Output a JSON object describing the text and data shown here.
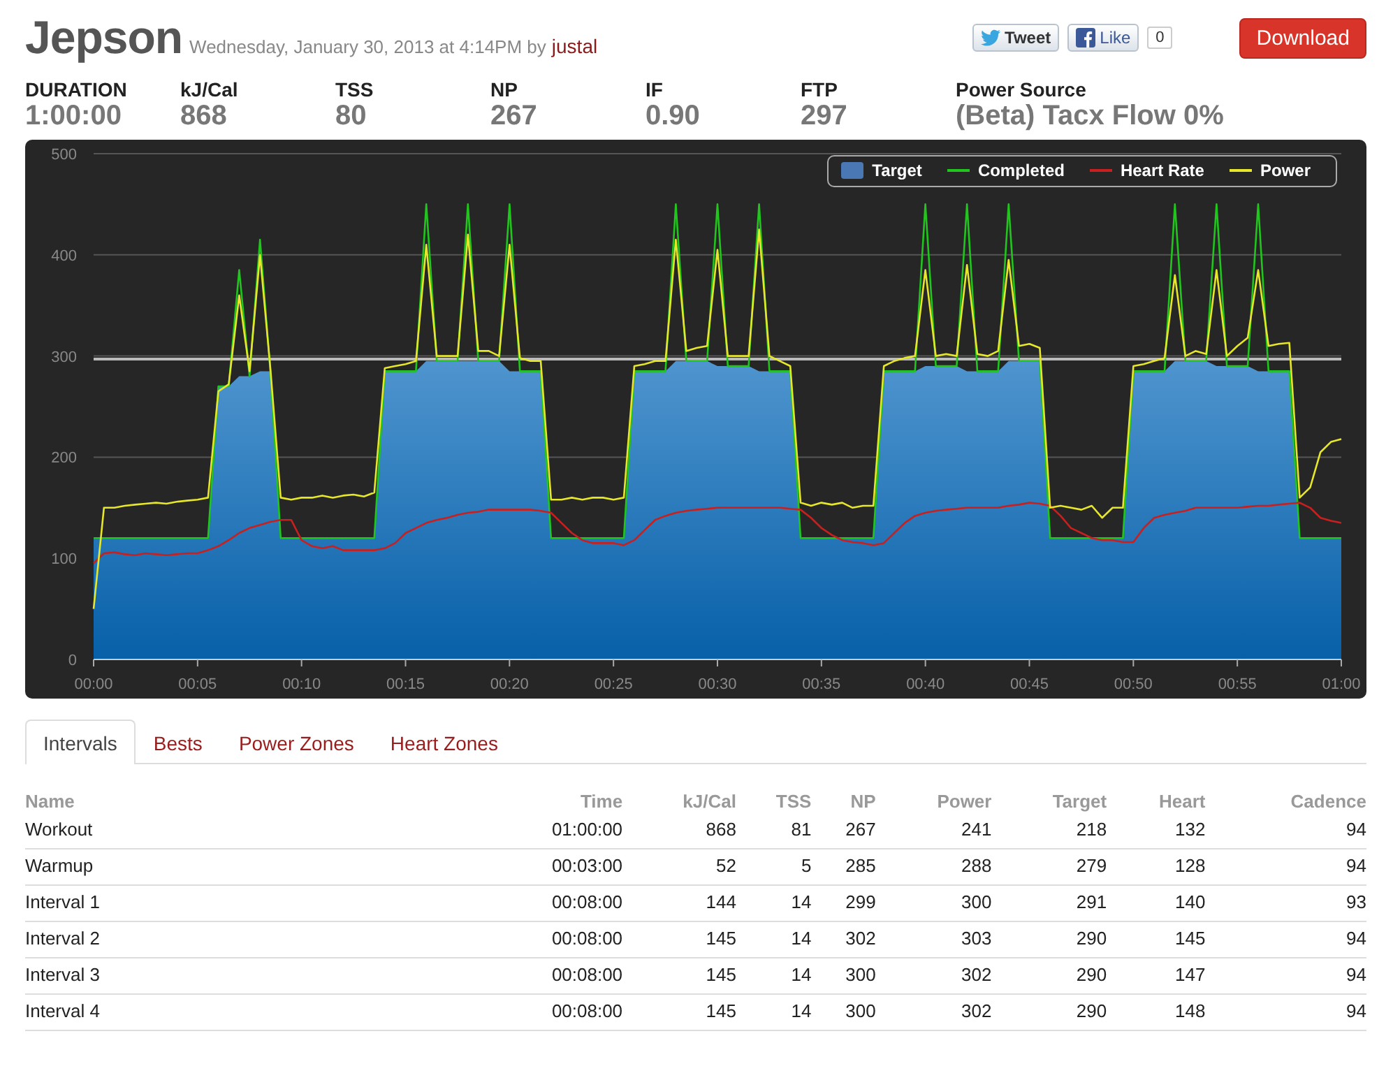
{
  "header": {
    "title": "Jepson",
    "meta": "Wednesday, January 30, 2013 at 4:14PM by",
    "author": "justal",
    "tweet": "Tweet",
    "like": "Like",
    "like_count": "0",
    "download": "Download"
  },
  "stats": [
    {
      "label": "DURATION",
      "value": "1:00:00"
    },
    {
      "label": "kJ/Cal",
      "value": "868"
    },
    {
      "label": "TSS",
      "value": "80"
    },
    {
      "label": "NP",
      "value": "267"
    },
    {
      "label": "IF",
      "value": "0.90"
    },
    {
      "label": "FTP",
      "value": "297"
    },
    {
      "label": "Power Source",
      "value": "(Beta) Tacx Flow 0%"
    }
  ],
  "chart": {
    "chart_data": {
      "type": "line",
      "x": [
        0,
        0.5,
        1,
        1.5,
        2,
        2.5,
        3,
        3.5,
        4,
        4.5,
        5,
        5.5,
        6,
        6.5,
        7,
        7.5,
        8,
        8.5,
        9,
        9.5,
        10,
        10.5,
        11,
        11.5,
        12,
        12.5,
        13,
        13.5,
        14,
        14.5,
        15,
        15.5,
        16,
        16.5,
        17,
        17.5,
        18,
        18.5,
        19,
        19.5,
        20,
        20.5,
        21,
        21.5,
        22,
        22.5,
        23,
        23.5,
        24,
        24.5,
        25,
        25.5,
        26,
        26.5,
        27,
        27.5,
        28,
        28.5,
        29,
        29.5,
        30,
        30.5,
        31,
        31.5,
        32,
        32.5,
        33,
        33.5,
        34,
        34.5,
        35,
        35.5,
        36,
        36.5,
        37,
        37.5,
        38,
        38.5,
        39,
        39.5,
        40,
        40.5,
        41,
        41.5,
        42,
        42.5,
        43,
        43.5,
        44,
        44.5,
        45,
        45.5,
        46,
        46.5,
        47,
        47.5,
        48,
        48.5,
        49,
        49.5,
        50,
        50.5,
        51,
        51.5,
        52,
        52.5,
        53,
        53.5,
        54,
        54.5,
        55,
        55.5,
        56,
        56.5,
        57,
        57.5,
        58,
        58.5,
        59,
        59.5,
        60
      ],
      "series": [
        {
          "name": "Target",
          "type": "area",
          "color": "#4a78b5",
          "values": [
            120,
            120,
            120,
            120,
            120,
            120,
            120,
            120,
            120,
            120,
            120,
            120,
            270,
            270,
            280,
            280,
            285,
            285,
            120,
            120,
            120,
            120,
            120,
            120,
            120,
            120,
            120,
            120,
            285,
            285,
            285,
            285,
            295,
            295,
            295,
            295,
            295,
            295,
            295,
            295,
            285,
            285,
            285,
            285,
            120,
            120,
            120,
            120,
            120,
            120,
            120,
            120,
            285,
            285,
            285,
            285,
            295,
            295,
            295,
            295,
            290,
            290,
            290,
            290,
            285,
            285,
            285,
            285,
            120,
            120,
            120,
            120,
            120,
            120,
            120,
            120,
            285,
            285,
            285,
            285,
            290,
            290,
            290,
            290,
            285,
            285,
            285,
            285,
            295,
            295,
            295,
            295,
            120,
            120,
            120,
            120,
            120,
            120,
            120,
            120,
            285,
            285,
            285,
            285,
            295,
            295,
            295,
            295,
            290,
            290,
            290,
            290,
            285,
            285,
            285,
            285,
            120,
            120,
            120,
            120,
            120
          ]
        },
        {
          "name": "Completed",
          "type": "line",
          "color": "#22c41e",
          "values": [
            120,
            120,
            120,
            120,
            120,
            120,
            120,
            120,
            120,
            120,
            120,
            120,
            270,
            270,
            385,
            280,
            415,
            285,
            120,
            120,
            120,
            120,
            120,
            120,
            120,
            120,
            120,
            120,
            285,
            285,
            285,
            285,
            450,
            295,
            295,
            295,
            450,
            295,
            295,
            295,
            450,
            285,
            285,
            285,
            120,
            120,
            120,
            120,
            120,
            120,
            120,
            120,
            285,
            285,
            285,
            285,
            450,
            295,
            295,
            295,
            450,
            290,
            290,
            290,
            450,
            285,
            285,
            285,
            120,
            120,
            120,
            120,
            120,
            120,
            120,
            120,
            285,
            285,
            285,
            285,
            450,
            290,
            290,
            290,
            450,
            285,
            285,
            285,
            450,
            295,
            295,
            295,
            120,
            120,
            120,
            120,
            120,
            120,
            120,
            120,
            285,
            285,
            285,
            285,
            450,
            295,
            295,
            295,
            450,
            290,
            290,
            290,
            450,
            285,
            285,
            285,
            120,
            120,
            120,
            120,
            120
          ]
        },
        {
          "name": "Heart Rate",
          "type": "line",
          "color": "#c8201e",
          "values": [
            95,
            105,
            106,
            104,
            103,
            105,
            104,
            103,
            104,
            105,
            105,
            108,
            112,
            118,
            125,
            130,
            133,
            136,
            138,
            138,
            118,
            112,
            110,
            112,
            108,
            108,
            108,
            108,
            110,
            115,
            125,
            130,
            135,
            138,
            140,
            143,
            145,
            146,
            148,
            148,
            148,
            148,
            148,
            147,
            145,
            135,
            125,
            118,
            115,
            115,
            115,
            113,
            118,
            128,
            138,
            142,
            145,
            147,
            148,
            149,
            150,
            150,
            150,
            150,
            150,
            150,
            150,
            149,
            148,
            140,
            130,
            123,
            118,
            116,
            115,
            113,
            115,
            125,
            135,
            142,
            145,
            147,
            148,
            149,
            150,
            150,
            150,
            150,
            152,
            153,
            155,
            154,
            152,
            142,
            130,
            125,
            120,
            118,
            118,
            116,
            116,
            130,
            140,
            143,
            145,
            147,
            150,
            150,
            150,
            150,
            150,
            151,
            152,
            152,
            153,
            154,
            155,
            150,
            140,
            137,
            135
          ]
        },
        {
          "name": "Power",
          "type": "line",
          "color": "#e6e62a",
          "values": [
            50,
            150,
            150,
            152,
            153,
            154,
            155,
            154,
            156,
            157,
            158,
            160,
            265,
            272,
            360,
            285,
            400,
            288,
            160,
            158,
            160,
            160,
            162,
            160,
            162,
            163,
            161,
            165,
            288,
            290,
            292,
            295,
            410,
            300,
            300,
            300,
            420,
            305,
            305,
            300,
            410,
            298,
            295,
            295,
            158,
            158,
            160,
            158,
            160,
            160,
            158,
            160,
            290,
            292,
            295,
            295,
            415,
            305,
            308,
            310,
            405,
            300,
            300,
            300,
            425,
            300,
            295,
            290,
            155,
            152,
            155,
            153,
            155,
            150,
            152,
            152,
            290,
            295,
            298,
            300,
            385,
            300,
            302,
            300,
            390,
            302,
            300,
            305,
            395,
            310,
            312,
            308,
            150,
            152,
            150,
            148,
            152,
            140,
            150,
            150,
            290,
            292,
            295,
            298,
            380,
            300,
            305,
            302,
            385,
            300,
            310,
            318,
            385,
            310,
            312,
            313,
            160,
            170,
            205,
            215,
            218
          ]
        }
      ],
      "xlim": [
        0,
        60
      ],
      "ylim": [
        0,
        500
      ],
      "xticks": [
        {
          "value": 0,
          "label": "00:00"
        },
        {
          "value": 5,
          "label": "00:05"
        },
        {
          "value": 10,
          "label": "00:10"
        },
        {
          "value": 15,
          "label": "00:15"
        },
        {
          "value": 20,
          "label": "00:20"
        },
        {
          "value": 25,
          "label": "00:25"
        },
        {
          "value": 30,
          "label": "00:30"
        },
        {
          "value": 35,
          "label": "00:35"
        },
        {
          "value": 40,
          "label": "00:40"
        },
        {
          "value": 45,
          "label": "00:45"
        },
        {
          "value": 50,
          "label": "00:50"
        },
        {
          "value": 55,
          "label": "00:55"
        },
        {
          "value": 60,
          "label": "01:00"
        }
      ],
      "yticks": [
        0,
        100,
        200,
        300,
        400,
        500
      ],
      "ref_lines": [
        {
          "axis": "y",
          "value": 297
        }
      ],
      "grid": true,
      "legend": "upper right"
    }
  },
  "tabs": [
    {
      "label": "Intervals",
      "selected": true
    },
    {
      "label": "Bests",
      "selected": false
    },
    {
      "label": "Power Zones",
      "selected": false
    },
    {
      "label": "Heart Zones",
      "selected": false
    }
  ],
  "table": {
    "columns": [
      "Name",
      "Time",
      "kJ/Cal",
      "TSS",
      "NP",
      "Power",
      "Target",
      "Heart",
      "Cadence"
    ],
    "rows": [
      [
        "Workout",
        "01:00:00",
        "868",
        "81",
        "267",
        "241",
        "218",
        "132",
        "94"
      ],
      [
        "Warmup",
        "00:03:00",
        "52",
        "5",
        "285",
        "288",
        "279",
        "128",
        "94"
      ],
      [
        "Interval 1",
        "00:08:00",
        "144",
        "14",
        "299",
        "300",
        "291",
        "140",
        "93"
      ],
      [
        "Interval 2",
        "00:08:00",
        "145",
        "14",
        "302",
        "303",
        "290",
        "145",
        "94"
      ],
      [
        "Interval 3",
        "00:08:00",
        "145",
        "14",
        "300",
        "302",
        "290",
        "147",
        "94"
      ],
      [
        "Interval 4",
        "00:08:00",
        "145",
        "14",
        "300",
        "302",
        "290",
        "148",
        "94"
      ]
    ]
  }
}
